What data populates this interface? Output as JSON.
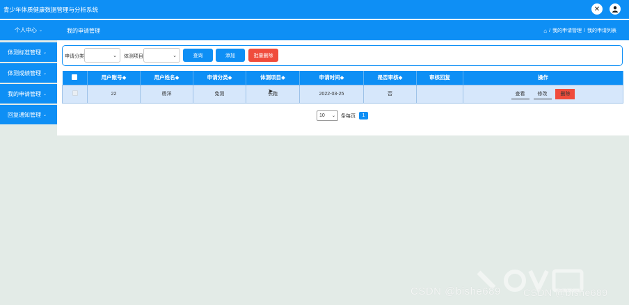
{
  "header": {
    "app_title": "青少年体质健康数据管理与分析系统"
  },
  "sidebar": {
    "head": "个人中心",
    "items": [
      {
        "label": "体测标准管理"
      },
      {
        "label": "体测成绩管理"
      },
      {
        "label": "我的申请管理"
      },
      {
        "label": "回复通知管理"
      }
    ]
  },
  "subheader": {
    "title": "我的申请管理",
    "breadcrumb": [
      "我的申请管理",
      "我的申请列表"
    ]
  },
  "search": {
    "category_label": "申请分类",
    "item_label": "体测项目",
    "query_button": "查询",
    "add_button": "添加",
    "batch_delete_button": "批量删除"
  },
  "table": {
    "headers": [
      "用户账号◆",
      "用户姓名◆",
      "申请分类◆",
      "体测项目◆",
      "申请时间◆",
      "是否审核◆",
      "审核回复",
      "操作"
    ],
    "rows": [
      {
        "account": "22",
        "name": "杨洋",
        "category": "免测",
        "item": "长跑",
        "time": "2022-03-25",
        "audited": "否",
        "reply": ""
      }
    ],
    "actions": {
      "view": "查看",
      "edit": "修改",
      "delete": "删除"
    }
  },
  "pagination": {
    "page_size": "10",
    "per_page_label": "条每页",
    "current_page": "1"
  },
  "watermark": {
    "text1": "CSDN @bishe689",
    "text2": "CSDN @bishe689"
  },
  "colors": {
    "primary": "#0e8ff5",
    "danger": "#f04c3c",
    "row_bg": "#d6e7fb",
    "page_bg": "#e3ebe7"
  }
}
